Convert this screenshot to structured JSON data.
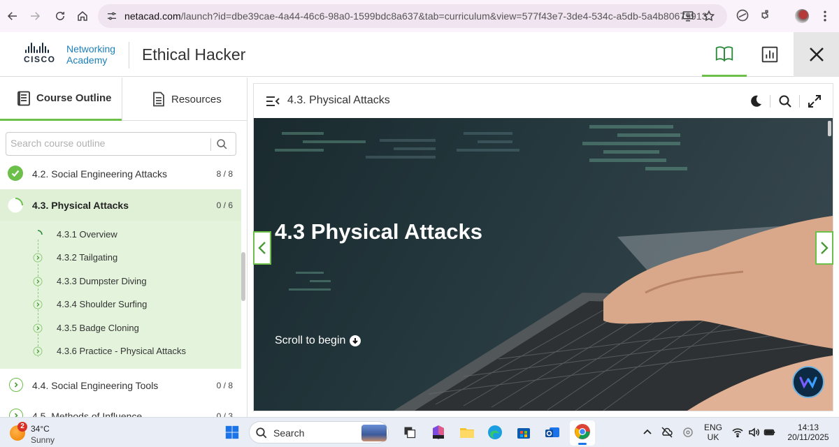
{
  "browser": {
    "url_host": "netacad.com",
    "url_rest": "/launch?id=dbe39cae-4a44-46c6-98a0-1599bdc8a637&tab=curriculum&view=577f43e7-3de4-534c-a5db-5a4b80679913"
  },
  "header": {
    "brand_line1": "Networking",
    "brand_line2": "Academy",
    "brand_logo": "CISCO",
    "course_title": "Ethical Hacker"
  },
  "sidebar": {
    "tabs": [
      {
        "label": "Course Outline",
        "active": true
      },
      {
        "label": "Resources",
        "active": false
      }
    ],
    "search_placeholder": "Search course outline",
    "modules": [
      {
        "title": "4.2. Social Engineering Attacks",
        "count": "8 / 8",
        "status": "complete"
      },
      {
        "title": "4.3. Physical Attacks",
        "count": "0 / 6",
        "status": "in-progress"
      },
      {
        "title": "4.4. Social Engineering Tools",
        "count": "0 / 8",
        "status": "not-started"
      },
      {
        "title": "4.5. Methods of Influence",
        "count": "0 / 3",
        "status": "not-started"
      }
    ],
    "topics": [
      {
        "label": "4.3.1 Overview",
        "status": "current"
      },
      {
        "label": "4.3.2 Tailgating",
        "status": "pending"
      },
      {
        "label": "4.3.3 Dumpster Diving",
        "status": "pending"
      },
      {
        "label": "4.3.4 Shoulder Surfing",
        "status": "pending"
      },
      {
        "label": "4.3.5 Badge Cloning",
        "status": "pending"
      },
      {
        "label": "4.3.6 Practice - Physical Attacks",
        "status": "pending"
      }
    ]
  },
  "content": {
    "title": "4.3. Physical Attacks",
    "hero_title": "4.3 Physical Attacks",
    "scroll_hint": "Scroll to begin"
  },
  "taskbar": {
    "weather_temp": "34°C",
    "weather_cond": "Sunny",
    "weather_badge": "2",
    "search_label": "Search",
    "lang_line1": "ENG",
    "lang_line2": "UK",
    "time": "14:13",
    "date": "20/11/2025"
  },
  "colors": {
    "accent_green": "#6cc04a",
    "highlight_green": "#e4f4dc",
    "cisco_blue": "#1d7fb8"
  }
}
